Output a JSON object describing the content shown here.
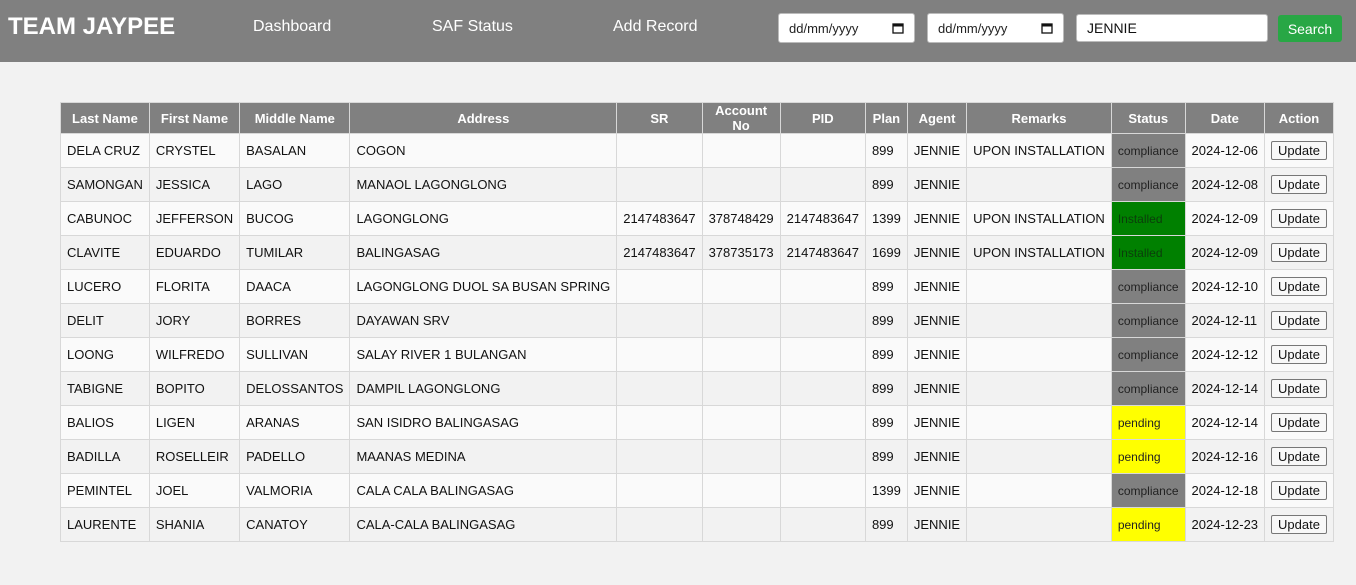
{
  "header": {
    "brand": "TEAM JAYPEE",
    "nav": [
      "Dashboard",
      "SAF Status",
      "Add Record"
    ],
    "date_from_placeholder": "dd/mm/yyyy",
    "date_to_placeholder": "dd/mm/yyyy",
    "search_value": "JENNIE",
    "search_label": "Search"
  },
  "colors": {
    "header_bg": "#808080",
    "search_button": "#28a745",
    "status_compliance": "#808080",
    "status_installed": "#008000",
    "status_pending": "#ffff00"
  },
  "table": {
    "columns": [
      "Last Name",
      "First Name",
      "Middle Name",
      "Address",
      "SR",
      "Account No",
      "PID",
      "Plan",
      "Agent",
      "Remarks",
      "Status",
      "Date",
      "Action"
    ],
    "action_label": "Update",
    "rows": [
      [
        "DELA CRUZ",
        "CRYSTEL",
        "BASALAN",
        "COGON",
        "",
        "",
        "",
        "899",
        "JENNIE",
        "UPON INSTALLATION",
        "compliance",
        "2024-12-06"
      ],
      [
        "SAMONGAN",
        "JESSICA",
        "LAGO",
        "MANAOL LAGONGLONG",
        "",
        "",
        "",
        "899",
        "JENNIE",
        "",
        "compliance",
        "2024-12-08"
      ],
      [
        "CABUNOC",
        "JEFFERSON",
        "BUCOG",
        "LAGONGLONG",
        "2147483647",
        "378748429",
        "2147483647",
        "1399",
        "JENNIE",
        "UPON INSTALLATION",
        "Installed",
        "2024-12-09"
      ],
      [
        "CLAVITE",
        "EDUARDO",
        "TUMILAR",
        "BALINGASAG",
        "2147483647",
        "378735173",
        "2147483647",
        "1699",
        "JENNIE",
        "UPON INSTALLATION",
        "Installed",
        "2024-12-09"
      ],
      [
        "LUCERO",
        "FLORITA",
        "DAACA",
        "LAGONGLONG DUOL SA BUSAN SPRING",
        "",
        "",
        "",
        "899",
        "JENNIE",
        "",
        "compliance",
        "2024-12-10"
      ],
      [
        "DELIT",
        "JORY",
        "BORRES",
        "DAYAWAN SRV",
        "",
        "",
        "",
        "899",
        "JENNIE",
        "",
        "compliance",
        "2024-12-11"
      ],
      [
        "LOONG",
        "WILFREDO",
        "SULLIVAN",
        "SALAY RIVER 1 BULANGAN",
        "",
        "",
        "",
        "899",
        "JENNIE",
        "",
        "compliance",
        "2024-12-12"
      ],
      [
        "TABIGNE",
        "BOPITO",
        "DELOSSANTOS",
        "DAMPIL LAGONGLONG",
        "",
        "",
        "",
        "899",
        "JENNIE",
        "",
        "compliance",
        "2024-12-14"
      ],
      [
        "BALIOS",
        "LIGEN",
        "ARANAS",
        "SAN ISIDRO BALINGASAG",
        "",
        "",
        "",
        "899",
        "JENNIE",
        "",
        "pending",
        "2024-12-14"
      ],
      [
        "BADILLA",
        "ROSELLEIR",
        "PADELLO",
        "MAANAS MEDINA",
        "",
        "",
        "",
        "899",
        "JENNIE",
        "",
        "pending",
        "2024-12-16"
      ],
      [
        "PEMINTEL",
        "JOEL",
        "VALMORIA",
        "CALA CALA BALINGASAG",
        "",
        "",
        "",
        "1399",
        "JENNIE",
        "",
        "compliance",
        "2024-12-18"
      ],
      [
        "LAURENTE",
        "SHANIA",
        "CANATOY",
        "CALA-CALA BALINGASAG",
        "",
        "",
        "",
        "899",
        "JENNIE",
        "",
        "pending",
        "2024-12-23"
      ]
    ]
  }
}
